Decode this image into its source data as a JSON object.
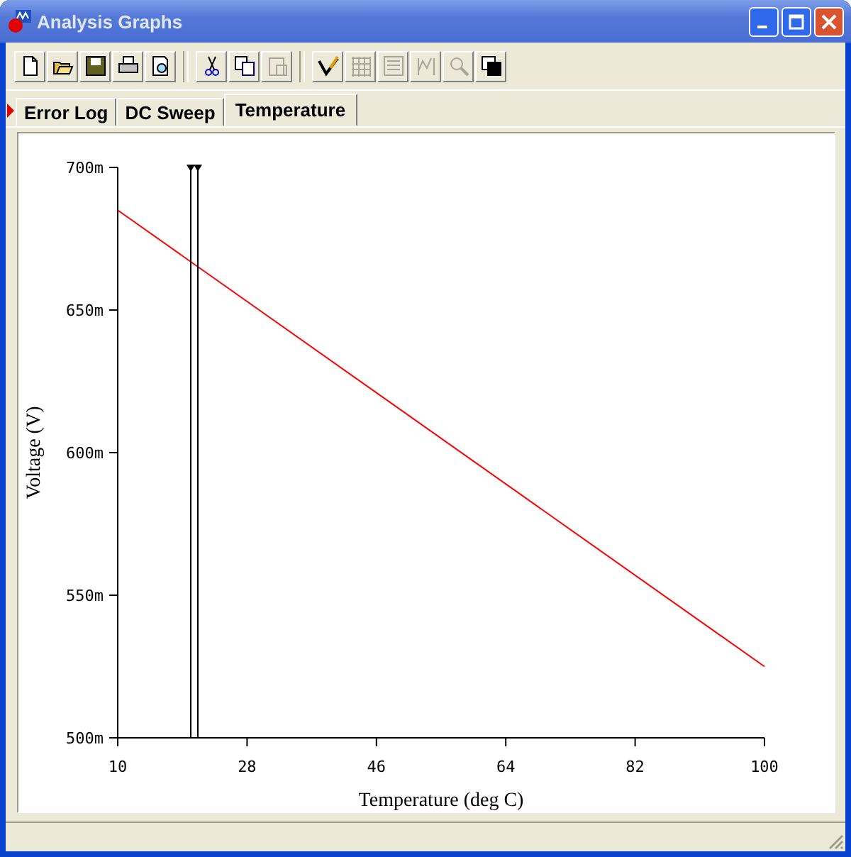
{
  "window": {
    "title": "Analysis Graphs"
  },
  "toolbar": [
    [
      {
        "kind": "new",
        "disabled": false
      },
      {
        "kind": "open",
        "disabled": false
      },
      {
        "kind": "save",
        "disabled": false
      },
      {
        "kind": "print",
        "disabled": false
      },
      {
        "kind": "preview",
        "disabled": false
      }
    ],
    [
      {
        "kind": "cut",
        "disabled": false
      },
      {
        "kind": "copy",
        "disabled": false
      },
      {
        "kind": "paste",
        "disabled": true
      }
    ],
    [
      {
        "kind": "properties",
        "disabled": false
      },
      {
        "kind": "grid",
        "disabled": true
      },
      {
        "kind": "legend",
        "disabled": true
      },
      {
        "kind": "cursors",
        "disabled": true
      },
      {
        "kind": "zoom",
        "disabled": true
      },
      {
        "kind": "overlay",
        "disabled": false
      }
    ]
  ],
  "tabs": [
    {
      "label": "Error Log",
      "selected": false,
      "flagged": true
    },
    {
      "label": "DC Sweep",
      "selected": false,
      "flagged": false
    },
    {
      "label": "Temperature",
      "selected": true,
      "flagged": false
    }
  ],
  "graph": {
    "chart_data": {
      "type": "line",
      "xlabel": "Temperature (deg C)",
      "ylabel": "Voltage (V)",
      "x": [
        10,
        100
      ],
      "series": [
        {
          "color": "#ff0000",
          "values": [
            685,
            525
          ]
        }
      ],
      "xlim": [
        10,
        100
      ],
      "ylim": [
        500,
        700
      ],
      "xticks": [
        10,
        28,
        46,
        64,
        82,
        100
      ],
      "yticks": [
        {
          "value": 500,
          "label": "500m"
        },
        {
          "value": 550,
          "label": "550m"
        },
        {
          "value": 600,
          "label": "600m"
        },
        {
          "value": 650,
          "label": "650m"
        },
        {
          "value": 700,
          "label": "700m"
        }
      ],
      "ref_lines": [
        {
          "axis": "x",
          "value": 20.1
        },
        {
          "axis": "x",
          "value": 21.1
        }
      ]
    }
  }
}
